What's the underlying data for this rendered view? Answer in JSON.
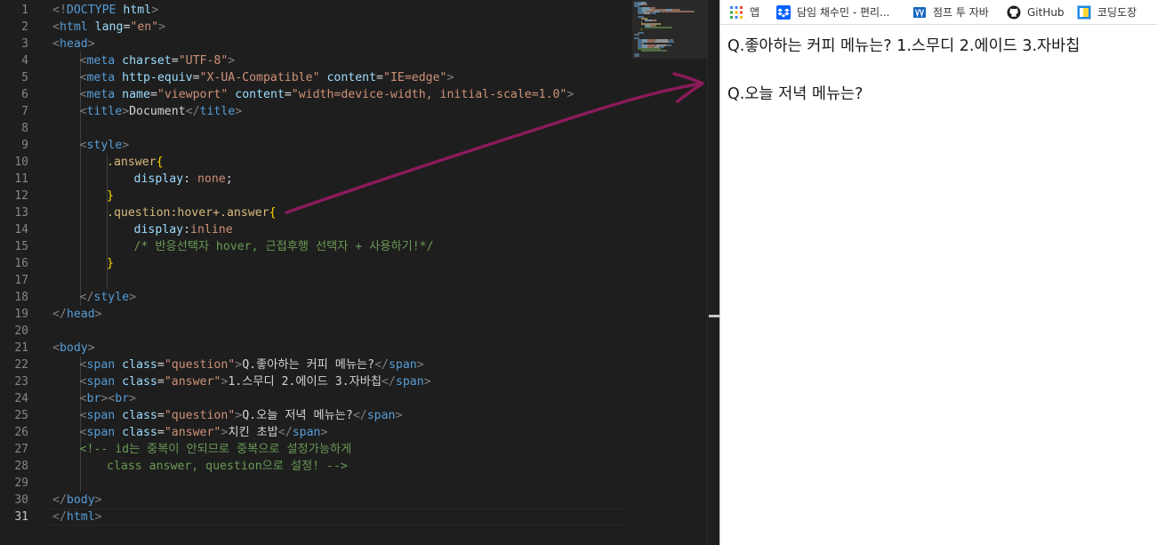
{
  "editor": {
    "line_numbers": [
      "1",
      "2",
      "3",
      "4",
      "5",
      "6",
      "7",
      "8",
      "9",
      "10",
      "11",
      "12",
      "13",
      "14",
      "15",
      "16",
      "17",
      "18",
      "19",
      "20",
      "21",
      "22",
      "23",
      "24",
      "25",
      "26",
      "27",
      "28",
      "29",
      "30",
      "31"
    ],
    "active_line": "31",
    "lines": [
      {
        "indent": 0,
        "tokens": [
          {
            "k": "br",
            "t": "<!"
          },
          {
            "k": "tag",
            "t": "DOCTYPE"
          },
          {
            "k": "txt",
            "t": " "
          },
          {
            "k": "attr",
            "t": "html"
          },
          {
            "k": "br",
            "t": ">"
          }
        ]
      },
      {
        "indent": 0,
        "tokens": [
          {
            "k": "br",
            "t": "<"
          },
          {
            "k": "tag",
            "t": "html"
          },
          {
            "k": "txt",
            "t": " "
          },
          {
            "k": "attr",
            "t": "lang"
          },
          {
            "k": "txt",
            "t": "="
          },
          {
            "k": "str",
            "t": "\"en\""
          },
          {
            "k": "br",
            "t": ">"
          }
        ]
      },
      {
        "indent": 0,
        "tokens": [
          {
            "k": "br",
            "t": "<"
          },
          {
            "k": "tag",
            "t": "head"
          },
          {
            "k": "br",
            "t": ">"
          }
        ]
      },
      {
        "indent": 1,
        "tokens": [
          {
            "k": "br",
            "t": "<"
          },
          {
            "k": "tag",
            "t": "meta"
          },
          {
            "k": "txt",
            "t": " "
          },
          {
            "k": "attr",
            "t": "charset"
          },
          {
            "k": "txt",
            "t": "="
          },
          {
            "k": "str",
            "t": "\"UTF-8\""
          },
          {
            "k": "br",
            "t": ">"
          }
        ]
      },
      {
        "indent": 1,
        "tokens": [
          {
            "k": "br",
            "t": "<"
          },
          {
            "k": "tag",
            "t": "meta"
          },
          {
            "k": "txt",
            "t": " "
          },
          {
            "k": "attr",
            "t": "http-equiv"
          },
          {
            "k": "txt",
            "t": "="
          },
          {
            "k": "str",
            "t": "\"X-UA-Compatible\""
          },
          {
            "k": "txt",
            "t": " "
          },
          {
            "k": "attr",
            "t": "content"
          },
          {
            "k": "txt",
            "t": "="
          },
          {
            "k": "str",
            "t": "\"IE=edge\""
          },
          {
            "k": "br",
            "t": ">"
          }
        ]
      },
      {
        "indent": 1,
        "tokens": [
          {
            "k": "br",
            "t": "<"
          },
          {
            "k": "tag",
            "t": "meta"
          },
          {
            "k": "txt",
            "t": " "
          },
          {
            "k": "attr",
            "t": "name"
          },
          {
            "k": "txt",
            "t": "="
          },
          {
            "k": "str",
            "t": "\"viewport\""
          },
          {
            "k": "txt",
            "t": " "
          },
          {
            "k": "attr",
            "t": "content"
          },
          {
            "k": "txt",
            "t": "="
          },
          {
            "k": "str",
            "t": "\"width=device-width, initial-scale=1.0\""
          },
          {
            "k": "br",
            "t": ">"
          }
        ]
      },
      {
        "indent": 1,
        "tokens": [
          {
            "k": "br",
            "t": "<"
          },
          {
            "k": "tag",
            "t": "title"
          },
          {
            "k": "br",
            "t": ">"
          },
          {
            "k": "txt",
            "t": "Document"
          },
          {
            "k": "br",
            "t": "</"
          },
          {
            "k": "tag",
            "t": "title"
          },
          {
            "k": "br",
            "t": ">"
          }
        ]
      },
      {
        "indent": 0,
        "tokens": []
      },
      {
        "indent": 1,
        "tokens": [
          {
            "k": "br",
            "t": "<"
          },
          {
            "k": "tag",
            "t": "style"
          },
          {
            "k": "br",
            "t": ">"
          }
        ]
      },
      {
        "indent": 2,
        "tokens": [
          {
            "k": "sel",
            "t": ".answer"
          },
          {
            "k": "brace",
            "t": "{"
          }
        ]
      },
      {
        "indent": 3,
        "tokens": [
          {
            "k": "prop",
            "t": "display"
          },
          {
            "k": "txt",
            "t": ": "
          },
          {
            "k": "val",
            "t": "none"
          },
          {
            "k": "txt",
            "t": ";"
          }
        ]
      },
      {
        "indent": 2,
        "tokens": [
          {
            "k": "brace",
            "t": "}"
          }
        ]
      },
      {
        "indent": 2,
        "tokens": [
          {
            "k": "sel",
            "t": ".question:hover+.answer"
          },
          {
            "k": "brace",
            "t": "{"
          }
        ]
      },
      {
        "indent": 3,
        "tokens": [
          {
            "k": "prop",
            "t": "display"
          },
          {
            "k": "txt",
            "t": ":"
          },
          {
            "k": "val",
            "t": "inline"
          }
        ]
      },
      {
        "indent": 3,
        "tokens": [
          {
            "k": "com",
            "t": "/* 반응선택자 hover, 근접후행 선택자 + 사용하기!*/"
          }
        ]
      },
      {
        "indent": 2,
        "tokens": [
          {
            "k": "brace",
            "t": "}"
          }
        ]
      },
      {
        "indent": 0,
        "tokens": []
      },
      {
        "indent": 1,
        "tokens": [
          {
            "k": "br",
            "t": "</"
          },
          {
            "k": "tag",
            "t": "style"
          },
          {
            "k": "br",
            "t": ">"
          }
        ]
      },
      {
        "indent": 0,
        "tokens": [
          {
            "k": "br",
            "t": "</"
          },
          {
            "k": "tag",
            "t": "head"
          },
          {
            "k": "br",
            "t": ">"
          }
        ]
      },
      {
        "indent": 0,
        "tokens": []
      },
      {
        "indent": 0,
        "tokens": [
          {
            "k": "br",
            "t": "<"
          },
          {
            "k": "tag",
            "t": "body"
          },
          {
            "k": "br",
            "t": ">"
          }
        ]
      },
      {
        "indent": 1,
        "tokens": [
          {
            "k": "br",
            "t": "<"
          },
          {
            "k": "tag",
            "t": "span"
          },
          {
            "k": "txt",
            "t": " "
          },
          {
            "k": "attr",
            "t": "class"
          },
          {
            "k": "txt",
            "t": "="
          },
          {
            "k": "str",
            "t": "\"question\""
          },
          {
            "k": "br",
            "t": ">"
          },
          {
            "k": "txt",
            "t": "Q.좋아하는 커피 메뉴는?"
          },
          {
            "k": "br",
            "t": "</"
          },
          {
            "k": "tag",
            "t": "span"
          },
          {
            "k": "br",
            "t": ">"
          }
        ]
      },
      {
        "indent": 1,
        "tokens": [
          {
            "k": "br",
            "t": "<"
          },
          {
            "k": "tag",
            "t": "span"
          },
          {
            "k": "txt",
            "t": " "
          },
          {
            "k": "attr",
            "t": "class"
          },
          {
            "k": "txt",
            "t": "="
          },
          {
            "k": "str",
            "t": "\"answer\""
          },
          {
            "k": "br",
            "t": ">"
          },
          {
            "k": "txt",
            "t": "1.스무디 2.에이드 3.자바칩"
          },
          {
            "k": "br",
            "t": "</"
          },
          {
            "k": "tag",
            "t": "span"
          },
          {
            "k": "br",
            "t": ">"
          }
        ]
      },
      {
        "indent": 1,
        "tokens": [
          {
            "k": "br",
            "t": "<"
          },
          {
            "k": "tag",
            "t": "br"
          },
          {
            "k": "br",
            "t": "><"
          },
          {
            "k": "tag",
            "t": "br"
          },
          {
            "k": "br",
            "t": ">"
          }
        ]
      },
      {
        "indent": 1,
        "tokens": [
          {
            "k": "br",
            "t": "<"
          },
          {
            "k": "tag",
            "t": "span"
          },
          {
            "k": "txt",
            "t": " "
          },
          {
            "k": "attr",
            "t": "class"
          },
          {
            "k": "txt",
            "t": "="
          },
          {
            "k": "str",
            "t": "\"question\""
          },
          {
            "k": "br",
            "t": ">"
          },
          {
            "k": "txt",
            "t": "Q.오늘 저녁 메뉴는?"
          },
          {
            "k": "br",
            "t": "</"
          },
          {
            "k": "tag",
            "t": "span"
          },
          {
            "k": "br",
            "t": ">"
          }
        ]
      },
      {
        "indent": 1,
        "tokens": [
          {
            "k": "br",
            "t": "<"
          },
          {
            "k": "tag",
            "t": "span"
          },
          {
            "k": "txt",
            "t": " "
          },
          {
            "k": "attr",
            "t": "class"
          },
          {
            "k": "txt",
            "t": "="
          },
          {
            "k": "str",
            "t": "\"answer\""
          },
          {
            "k": "br",
            "t": ">"
          },
          {
            "k": "txt",
            "t": "치킨 초밥"
          },
          {
            "k": "br",
            "t": "</"
          },
          {
            "k": "tag",
            "t": "span"
          },
          {
            "k": "br",
            "t": ">"
          }
        ]
      },
      {
        "indent": 1,
        "tokens": [
          {
            "k": "com",
            "t": "<!-- id는 중복이 안되므로 중복으로 설정가능하게"
          }
        ]
      },
      {
        "indent": 2,
        "tokens": [
          {
            "k": "com",
            "t": "class answer, question으로 설정! -->"
          }
        ]
      },
      {
        "indent": 0,
        "tokens": []
      },
      {
        "indent": 0,
        "tokens": [
          {
            "k": "br",
            "t": "</"
          },
          {
            "k": "tag",
            "t": "body"
          },
          {
            "k": "br",
            "t": ">"
          }
        ]
      },
      {
        "indent": 0,
        "tokens": [
          {
            "k": "br",
            "t": "</"
          },
          {
            "k": "tag",
            "t": "html"
          },
          {
            "k": "br",
            "t": ">"
          }
        ]
      }
    ],
    "colors": {
      "tag": "#569cd6",
      "bracket": "#808080",
      "attribute": "#9cdcfe",
      "string": "#ce9178",
      "selector": "#d7ba7d",
      "brace": "#ffd700",
      "comment": "#6a9955",
      "text": "#d4d4d4",
      "background": "#1e1e1e",
      "line_number": "#858585"
    }
  },
  "bookmarks": {
    "items": [
      {
        "label": "앱",
        "icon": "apps-grid-icon"
      },
      {
        "label": "담임 채수민 - 편리...",
        "icon": "dropbox-icon"
      },
      {
        "label": "점프 투 자바",
        "icon": "book-icon"
      },
      {
        "label": "GitHub",
        "icon": "github-icon"
      },
      {
        "label": "코딩도장",
        "icon": "coding-dojang-icon"
      }
    ]
  },
  "page": {
    "question1": "Q.좋아하는 커피 메뉴는?",
    "answer1": "1.스무디 2.에이드 3.자바칩",
    "question2": "Q.오늘 저녁 메뉴는?"
  },
  "annotation": {
    "arrow_color": "#8b1a5a",
    "arrow_icon": "hand-drawn-arrow-icon"
  }
}
